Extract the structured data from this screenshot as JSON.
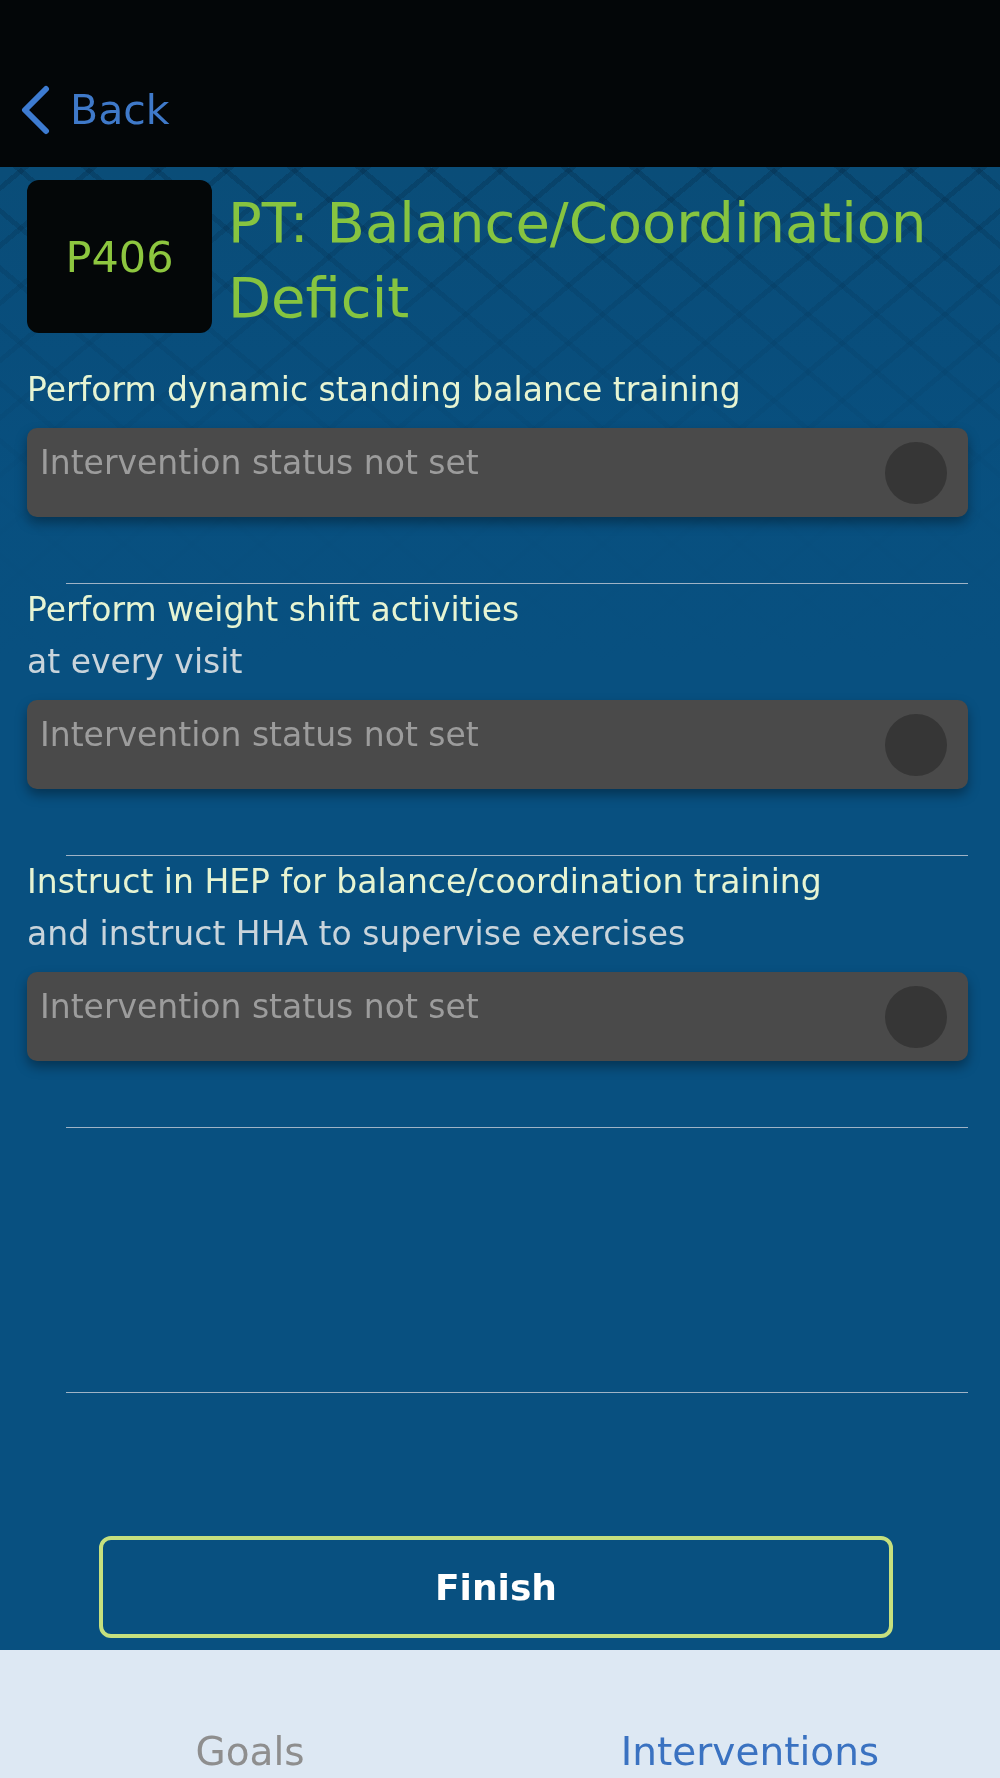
{
  "nav_bar": {
    "back_label": "Back"
  },
  "header": {
    "code": "P406",
    "title": "PT: Balance/Coordination Deficit"
  },
  "interventions": [
    {
      "title": "Perform dynamic standing balance training",
      "status": {
        "placeholder": "Intervention status not set"
      }
    },
    {
      "title": "Perform weight shift activities",
      "subtitle": "at every visit",
      "status": {
        "placeholder": "Intervention status not set"
      }
    },
    {
      "title": "Instruct in HEP for balance/coordination training",
      "subtitle": "and instruct HHA to supervise exercises",
      "status": {
        "placeholder": "Intervention status not set"
      }
    }
  ],
  "finish_button": {
    "label": "Finish"
  },
  "tabs": [
    {
      "label": "Goals",
      "selected": false
    },
    {
      "label": "Interventions",
      "selected": true
    }
  ]
}
